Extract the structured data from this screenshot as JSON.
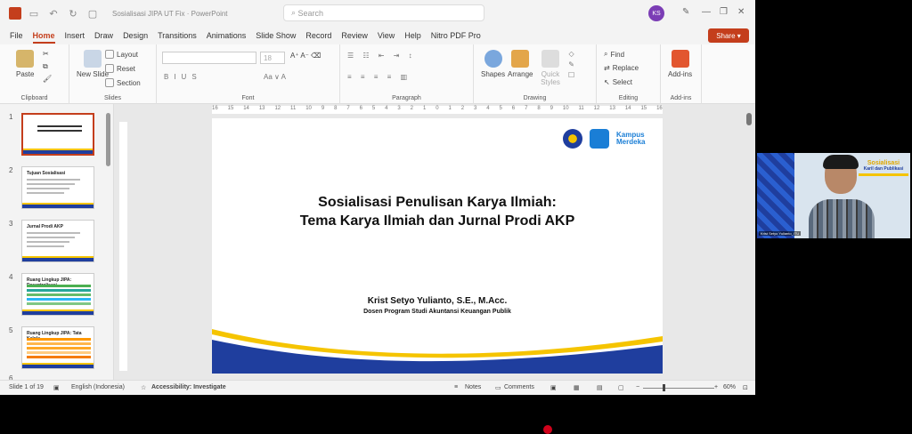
{
  "window": {
    "doc_title": "Sosialisasi JIPA UT Fix  ·  PowerPoint",
    "search_placeholder": "Search",
    "avatar_initials": "KS"
  },
  "menu": [
    "File",
    "Home",
    "Insert",
    "Draw",
    "Design",
    "Transitions",
    "Animations",
    "Slide Show",
    "Record",
    "Review",
    "View",
    "Help",
    "Nitro PDF Pro"
  ],
  "share_label": "Share",
  "ribbon": {
    "clipboard": {
      "label": "Clipboard",
      "paste": "Paste"
    },
    "slides": {
      "label": "Slides",
      "new_slide": "New Slide",
      "layout": "Layout",
      "reset": "Reset",
      "section": "Section"
    },
    "font": {
      "label": "Font",
      "size": "18"
    },
    "paragraph": {
      "label": "Paragraph"
    },
    "drawing": {
      "label": "Drawing",
      "shapes": "Shapes",
      "arrange": "Arrange",
      "quick_styles": "Quick Styles"
    },
    "editing": {
      "label": "Editing",
      "find": "Find",
      "replace": "Replace",
      "select": "Select"
    },
    "addins": {
      "label": "Add-ins",
      "addins": "Add-ins"
    }
  },
  "ruler_ticks": [
    "16",
    "15",
    "14",
    "13",
    "12",
    "11",
    "10",
    "9",
    "8",
    "7",
    "6",
    "5",
    "4",
    "3",
    "2",
    "1",
    "0",
    "1",
    "2",
    "3",
    "4",
    "5",
    "6",
    "7",
    "8",
    "9",
    "10",
    "11",
    "12",
    "13",
    "14",
    "15",
    "16"
  ],
  "thumbnails": [
    {
      "num": "1",
      "title": ""
    },
    {
      "num": "2",
      "title": "Tujuan Sosialisasi"
    },
    {
      "num": "3",
      "title": "Jurnal Prodi AKP"
    },
    {
      "num": "4",
      "title": "Ruang Lingkup JIPA: Desentralisasi"
    },
    {
      "num": "5",
      "title": "Ruang Lingkup JIPA: Tata Kelola"
    },
    {
      "num": "6",
      "title": ""
    }
  ],
  "slide": {
    "title_line1": "Sosialisasi Penulisan Karya Ilmiah:",
    "title_line2": "Tema Karya Ilmiah dan Jurnal Prodi AKP",
    "author": "Krist Setyo Yulianto, S.E., M.Acc.",
    "affiliation": "Dosen Program Studi Akuntansi Keuangan Publik",
    "logo_text_1": "Kampus",
    "logo_text_2": "Merdeka"
  },
  "status": {
    "slide_count": "Slide 1 of 19",
    "language": "English (Indonesia)",
    "accessibility": "Accessibility: Investigate",
    "notes": "Notes",
    "comments": "Comments",
    "zoom": "60%"
  },
  "camera": {
    "banner_title": "Sosialisasi",
    "banner_sub": "Karil dan Publikasi",
    "participant": "Krist Setyo Yulianto_ITU"
  },
  "colors": {
    "accent": "#c43e1c",
    "slide_blue": "#1f3e9e",
    "slide_yellow": "#f5c400"
  }
}
